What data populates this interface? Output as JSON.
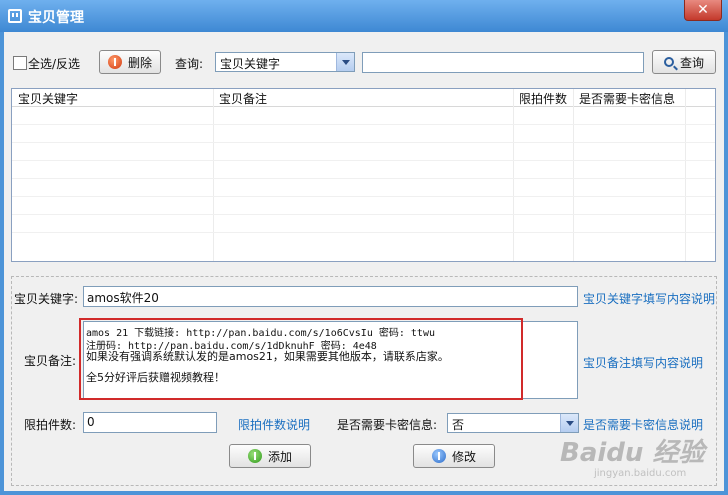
{
  "window": {
    "title": "宝贝管理",
    "close_glyph": "✕"
  },
  "toolbar": {
    "select_all_label": "全选/反选",
    "delete_label": "删除",
    "query_label": "查询:",
    "query_field_value": "宝贝关键字",
    "search_value": "",
    "search_button_label": "查询"
  },
  "grid": {
    "columns": [
      "宝贝关键字",
      "宝贝备注",
      "限拍件数",
      "是否需要卡密信息"
    ]
  },
  "form": {
    "keyword_label": "宝贝关键字:",
    "keyword_value": "amos软件20",
    "keyword_help": "宝贝关键字填写内容说明",
    "notes_label": "宝贝备注:",
    "notes_lines": [
      "amos 21 下载链接: http://pan.baidu.com/s/1o6CvsIu 密码: ttwu",
      "注册码: http://pan.baidu.com/s/1dDknuhF 密码: 4e48",
      "如果没有强调系统默认发的是amos21，如果需要其他版本，请联系店家。",
      "",
      "全5分好评后获赠视频教程！"
    ],
    "notes_help": "宝贝备注填写内容说明",
    "limit_label": "限拍件数:",
    "limit_value": "0",
    "limit_help": "限拍件数说明",
    "secret_label": "是否需要卡密信息:",
    "secret_value": "否",
    "secret_help": "是否需要卡密信息说明",
    "add_label": "添加",
    "modify_label": "修改"
  },
  "watermark": {
    "text": "Baidu 经验",
    "sub": "jingyan.baidu.com"
  },
  "colors": {
    "title_bar": "#4d94d8",
    "link": "#1a6fc0",
    "highlight": "#d12a2a"
  }
}
